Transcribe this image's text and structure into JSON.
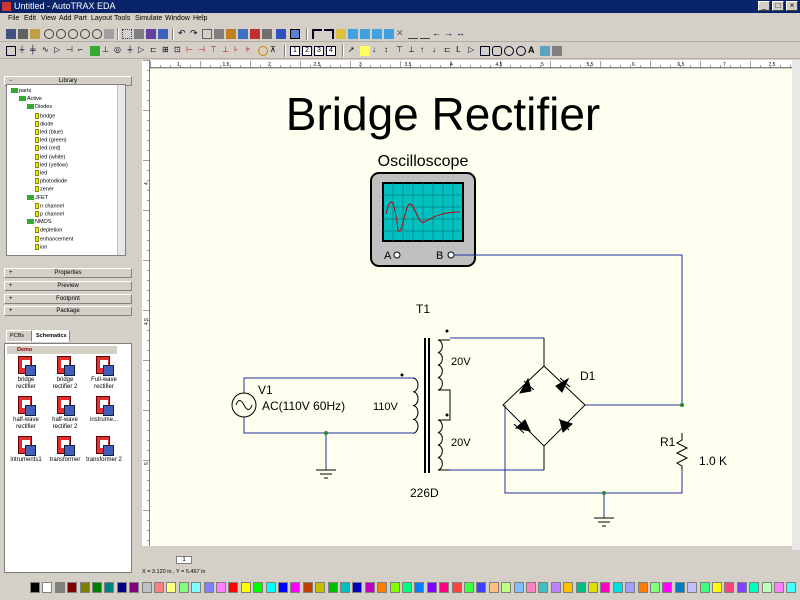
{
  "window": {
    "title": "Untitled - AutoTRAX EDA",
    "min": "_",
    "max": "□",
    "close": "×"
  },
  "menu": [
    "File",
    "Edit",
    "View",
    "Add",
    "Part",
    "Layout",
    "Tools",
    "Simulate",
    "Window",
    "Help"
  ],
  "library": {
    "header": "Library",
    "tree": [
      {
        "label": "parts",
        "depth": 0,
        "kind": "folder"
      },
      {
        "label": "Active",
        "depth": 1,
        "kind": "folder"
      },
      {
        "label": "Diodes",
        "depth": 2,
        "kind": "folder"
      },
      {
        "label": "bridge",
        "depth": 3,
        "kind": "leaf"
      },
      {
        "label": "diode",
        "depth": 3,
        "kind": "leaf"
      },
      {
        "label": "led (blue)",
        "depth": 3,
        "kind": "leaf"
      },
      {
        "label": "led (green)",
        "depth": 3,
        "kind": "leaf"
      },
      {
        "label": "led (red)",
        "depth": 3,
        "kind": "leaf"
      },
      {
        "label": "led (white)",
        "depth": 3,
        "kind": "leaf"
      },
      {
        "label": "led (yellow)",
        "depth": 3,
        "kind": "leaf"
      },
      {
        "label": "led",
        "depth": 3,
        "kind": "leaf"
      },
      {
        "label": "photodiode",
        "depth": 3,
        "kind": "leaf"
      },
      {
        "label": "zener",
        "depth": 3,
        "kind": "leaf"
      },
      {
        "label": "JFET",
        "depth": 2,
        "kind": "folder"
      },
      {
        "label": "n channel",
        "depth": 3,
        "kind": "leaf"
      },
      {
        "label": "p channel",
        "depth": 3,
        "kind": "leaf"
      },
      {
        "label": "NMOS",
        "depth": 2,
        "kind": "folder"
      },
      {
        "label": "depletion",
        "depth": 3,
        "kind": "leaf"
      },
      {
        "label": "enhancement",
        "depth": 3,
        "kind": "leaf"
      },
      {
        "label": "ion",
        "depth": 3,
        "kind": "leaf"
      }
    ],
    "panels": [
      "Properties",
      "Preview",
      "Footprint",
      "Package"
    ]
  },
  "tabs": [
    "PCBs",
    "Schematics"
  ],
  "gallery": {
    "group": "Demo",
    "items": [
      {
        "label": "bridge rectifier"
      },
      {
        "label": "bridge rectifier 2"
      },
      {
        "label": "Full-wave rectifier"
      },
      {
        "label": "half-wave rectifier"
      },
      {
        "label": "half-wave rectifier 2"
      },
      {
        "label": "instrume..."
      },
      {
        "label": "intruments1"
      },
      {
        "label": "transformer"
      },
      {
        "label": "transformer 2"
      }
    ]
  },
  "schematic": {
    "title": "Bridge Rectifier",
    "scope_label": "Oscilloscope",
    "scope_a": "A",
    "scope_b": "B",
    "v1_ref": "V1",
    "v1_value": "AC(110V 60Hz)",
    "t1_ref": "T1",
    "primary_v": "110V",
    "secondary_top": "20V",
    "secondary_bottom": "20V",
    "t1_value": "226D",
    "d1_ref": "D1",
    "r1_ref": "R1",
    "r1_value": "1.0 K",
    "wire_color": "#2030a0"
  },
  "ruler": {
    "h_ticks": [
      "1",
      "1.5",
      "2",
      "2.5",
      "3",
      "3.5",
      "4",
      "4.5",
      "5",
      "5.5",
      "6",
      "6.5",
      "7",
      "7.5"
    ],
    "v_ticks": [
      "4",
      "4.5",
      "5"
    ]
  },
  "sheet_tab": "1",
  "status": "X = 3.120 in , Y = 5.467 in",
  "palette": [
    "#000000",
    "#ffffff",
    "#808080",
    "#800000",
    "#808000",
    "#008000",
    "#008080",
    "#000080",
    "#800080",
    "#c0c0c0",
    "#ff8080",
    "#ffff80",
    "#80ff80",
    "#80ffff",
    "#8080ff",
    "#ff80ff",
    "#ff0000",
    "#ffff00",
    "#00ff00",
    "#00ffff",
    "#0000ff",
    "#ff00ff",
    "#c04000",
    "#c0c000",
    "#00c000",
    "#00c0c0",
    "#0000c0",
    "#c000c0",
    "#ff8000",
    "#80ff00",
    "#00ff80",
    "#0080ff",
    "#8000ff",
    "#ff0080",
    "#ff4040",
    "#40ff40",
    "#4040ff",
    "#ffc080",
    "#c0ff80",
    "#80c0ff",
    "#ff80c0",
    "#40c0c0",
    "#c080ff",
    "#ffc000",
    "#00c080",
    "#e0e000",
    "#ff00c0",
    "#00e0e0",
    "#a0a0ff",
    "#ff8000",
    "#80ff80",
    "#ff00ff",
    "#0080c0",
    "#c0c0ff",
    "#40ff80",
    "#ffff00",
    "#ff4080",
    "#8040ff",
    "#00ffc0",
    "#c0ffc0",
    "#ff80ff",
    "#40ffff"
  ]
}
